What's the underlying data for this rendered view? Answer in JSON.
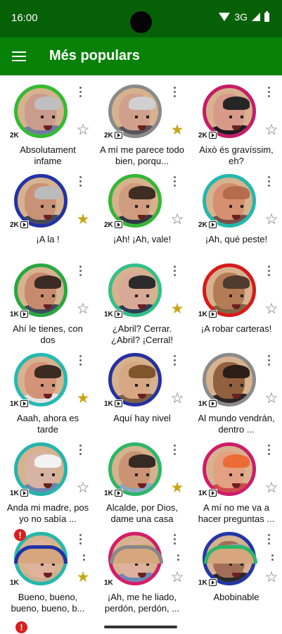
{
  "status": {
    "time": "16:00",
    "network": "3G",
    "icons": [
      "wifi-icon",
      "signal-icon",
      "battery-icon"
    ]
  },
  "appbar": {
    "title": "Més populars",
    "menu_icon": "menu-icon"
  },
  "items": [
    {
      "label": "Absolutament infame",
      "count": "2K",
      "video": false,
      "favorite": false,
      "ring": "#34ba34",
      "face": "#c99c8d",
      "hair": "#bfbfbf",
      "body": "#6f7ba0"
    },
    {
      "label": "A mí me parece todo bien, porqu...",
      "count": "2K",
      "video": true,
      "favorite": true,
      "ring": "#8a8a8a",
      "face": "#d1a08c",
      "hair": "#d0d0d0",
      "body": "#58545d"
    },
    {
      "label": "Això és gravíssim, eh?",
      "count": "2K",
      "video": true,
      "favorite": false,
      "ring": "#c51d68",
      "face": "#d79a88",
      "hair": "#252525",
      "body": "#1d1c20"
    },
    {
      "label": "¡A la          !",
      "count": "2K",
      "video": true,
      "favorite": true,
      "ring": "#2332a5",
      "face": "#c99175",
      "hair": "#bbbbbb",
      "body": "#444b56"
    },
    {
      "label": "¡Ah! ¡Ah, vale!",
      "count": "2K",
      "video": true,
      "favorite": false,
      "ring": "#35b735",
      "face": "#d09c7f",
      "hair": "#3e2d22",
      "body": "#303845"
    },
    {
      "label": "¡Ah, qué peste!",
      "count": "2K",
      "video": true,
      "favorite": false,
      "ring": "#22b8ad",
      "face": "#d58f71",
      "hair": "#b56b4e",
      "body": "#784f49"
    },
    {
      "label": "Ahí le tienes, con dos",
      "count": "1K",
      "video": true,
      "favorite": false,
      "ring": "#26a842",
      "face": "#c88a6e",
      "hair": "#3c2b24",
      "body": "#3e4b5a"
    },
    {
      "label": "¿Abril? Cerrar. ¿Abril? ¡Cerral!",
      "count": "1K",
      "video": true,
      "favorite": true,
      "ring": "#32c088",
      "face": "#d9a997",
      "hair": "#2b2b2b",
      "body": "#2b3d57"
    },
    {
      "label": "¡A robar carteras!",
      "count": "1K",
      "video": true,
      "favorite": false,
      "ring": "#d71a1a",
      "face": "#b47c55",
      "hair": "#4e3b2d",
      "body": "#7d6744"
    },
    {
      "label": "Aaah, ahora es tarde",
      "count": "1K",
      "video": true,
      "favorite": true,
      "ring": "#25b9b3",
      "face": "#d49378",
      "hair": "#3b2c22",
      "body": "#e5e5e5"
    },
    {
      "label": "Aquí hay nivel",
      "count": "1K",
      "video": true,
      "favorite": false,
      "ring": "#26309f",
      "face": "#d7a784",
      "hair": "#80552e",
      "body": "#7d6041"
    },
    {
      "label": "Al mundo vendrán, dentro ...",
      "count": "1K",
      "video": true,
      "favorite": false,
      "ring": "#8b8b8b",
      "face": "#90603f",
      "hair": "#2a1e17",
      "body": "#2b2623"
    },
    {
      "label": "Anda mi madre, pos yo no sabía ...",
      "count": "1K",
      "video": true,
      "favorite": false,
      "ring": "#24b5ad",
      "face": "#d7b3a4",
      "hair": "#f2f2f2",
      "body": "#6c84af"
    },
    {
      "label": "Alcalde, por Dios, dame una casa",
      "count": "1K",
      "video": true,
      "favorite": true,
      "ring": "#2bb768",
      "face": "#c99374",
      "hair": "#372923",
      "body": "#8ca7c2"
    },
    {
      "label": "A mí no me va a hacer preguntas ...",
      "count": "1K",
      "video": true,
      "favorite": false,
      "ring": "#cc1d6a",
      "face": "#e4a082",
      "hair": "#ed6c35",
      "body": "#cf4c49"
    },
    {
      "label": "Bueno, bueno, bueno, bueno, b...",
      "count": "1K",
      "video": false,
      "favorite": true,
      "ring": "#23b8aa",
      "face": "#e0b29c",
      "hair": "#dcc07a",
      "body": "#c8b090",
      "alert": "!"
    },
    {
      "label": "¡Ah, me he liado, perdón, perdón, ...",
      "count": "1K",
      "video": false,
      "favorite": false,
      "ring": "#d21f68",
      "face": "#deb19c",
      "hair": "#d7b06a",
      "body": "#6b88b6"
    },
    {
      "label": "Abobinable",
      "count": "1K",
      "video": true,
      "favorite": false,
      "ring": "#2337a6",
      "face": "#a26e57",
      "hair": "#9a9a9a",
      "body": "#2a2929"
    }
  ]
}
